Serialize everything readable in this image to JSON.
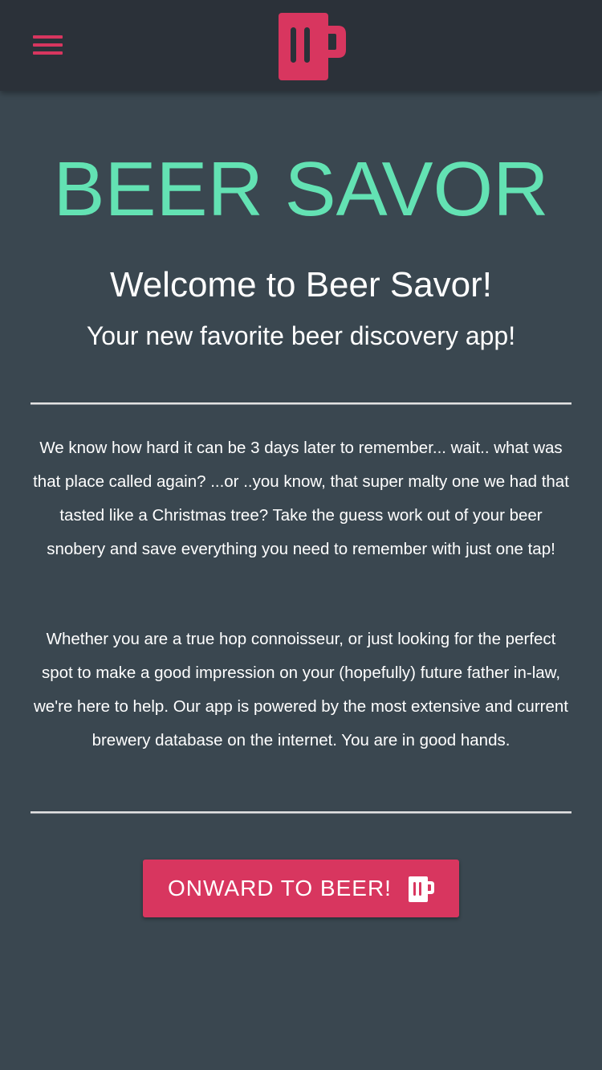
{
  "header": {
    "menu_icon": "hamburger-menu-icon",
    "logo_icon": "beer-mug-icon"
  },
  "hero": {
    "title": "BEER SAVOR",
    "welcome": "Welcome to Beer Savor!",
    "tagline": "Your new favorite beer discovery app!"
  },
  "content": {
    "paragraph_1": "We know how hard it can be 3 days later to remember... wait.. what was that place called again? ...or ..you know, that super malty one we had that tasted like a Christmas tree? Take the guess work out of your beer snobery and save everything you need to remember with just one tap!",
    "paragraph_2": "Whether you are a true hop connoisseur, or just looking for the perfect spot to make a good impression on your (hopefully) future father in-law, we're here to help. Our app is powered by the most extensive and current brewery database on the internet. You are in good hands."
  },
  "cta": {
    "label": "ONWARD TO BEER!",
    "icon": "beer-mug-icon"
  },
  "colors": {
    "background": "#3a4750",
    "app_bar": "#2b3139",
    "accent": "#d8365f",
    "title": "#63e2b3",
    "text": "#ffffff"
  }
}
